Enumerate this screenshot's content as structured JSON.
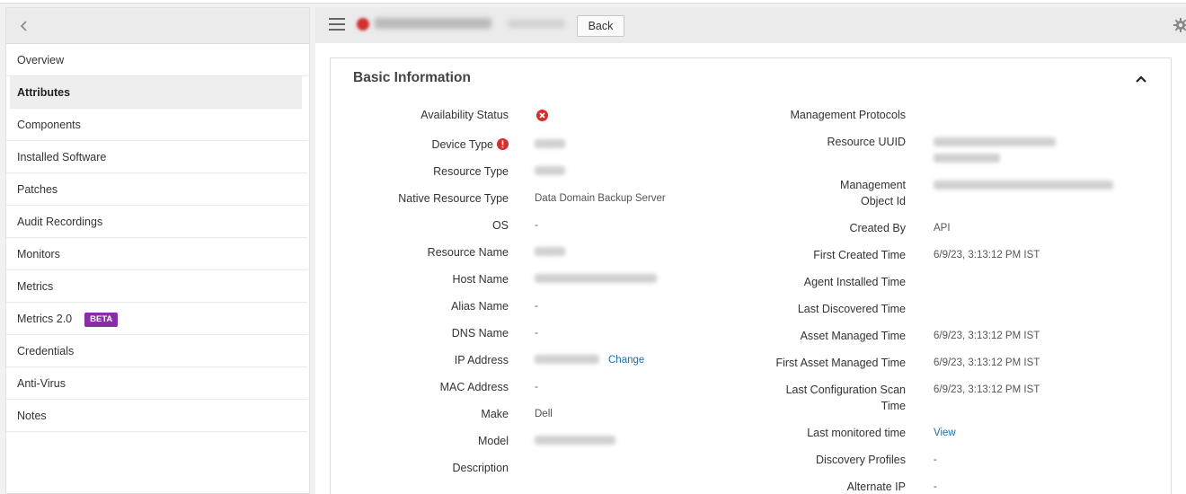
{
  "sidebar": {
    "items": [
      {
        "label": "Overview"
      },
      {
        "label": "Attributes"
      },
      {
        "label": "Components"
      },
      {
        "label": "Installed Software"
      },
      {
        "label": "Patches"
      },
      {
        "label": "Audit Recordings"
      },
      {
        "label": "Monitors"
      },
      {
        "label": "Metrics"
      },
      {
        "label": "Metrics 2.0",
        "badge": "BETA"
      },
      {
        "label": "Credentials"
      },
      {
        "label": "Anti-Virus"
      },
      {
        "label": "Notes"
      }
    ],
    "active_index": 1
  },
  "toolbar": {
    "back_label": "Back"
  },
  "panel": {
    "title": "Basic Information"
  },
  "left_fields": [
    {
      "label": "Availability Status",
      "value": ""
    },
    {
      "label": "Device Type",
      "value": ""
    },
    {
      "label": "Resource Type",
      "value": ""
    },
    {
      "label": "Native Resource Type",
      "value": "Data Domain Backup Server"
    },
    {
      "label": "OS",
      "value": "-"
    },
    {
      "label": "Resource Name",
      "value": ""
    },
    {
      "label": "Host Name",
      "value": ""
    },
    {
      "label": "Alias Name",
      "value": "-"
    },
    {
      "label": "DNS Name",
      "value": "-"
    },
    {
      "label": "IP Address",
      "value": "",
      "action": "Change"
    },
    {
      "label": "MAC Address",
      "value": "-"
    },
    {
      "label": "Make",
      "value": "Dell"
    },
    {
      "label": "Model",
      "value": ""
    },
    {
      "label": "Description",
      "value": ""
    }
  ],
  "right_fields": [
    {
      "label": "Management Protocols",
      "value": ""
    },
    {
      "label": "Resource UUID",
      "value": ""
    },
    {
      "label_line1": "Management",
      "label_line2": "Object Id",
      "value": ""
    },
    {
      "label": "Created By",
      "value": "API"
    },
    {
      "label": "First Created Time",
      "value": "6/9/23, 3:13:12 PM IST"
    },
    {
      "label": "Agent Installed Time",
      "value": ""
    },
    {
      "label": "Last Discovered Time",
      "value": ""
    },
    {
      "label": "Asset Managed Time",
      "value": "6/9/23, 3:13:12 PM IST"
    },
    {
      "label": "First Asset Managed Time",
      "value": "6/9/23, 3:13:12 PM IST"
    },
    {
      "label_line1": "Last Configuration Scan",
      "label_line2": "Time",
      "value": "6/9/23, 3:13:12 PM IST"
    },
    {
      "label": "Last monitored time",
      "value": "View"
    },
    {
      "label": "Discovery Profiles",
      "value": "-"
    },
    {
      "label": "Alternate IP",
      "value": "-"
    }
  ],
  "colors": {
    "error": "#d32f2f",
    "link": "#1a6fa8",
    "beta_badge": "#8a2ea8"
  }
}
